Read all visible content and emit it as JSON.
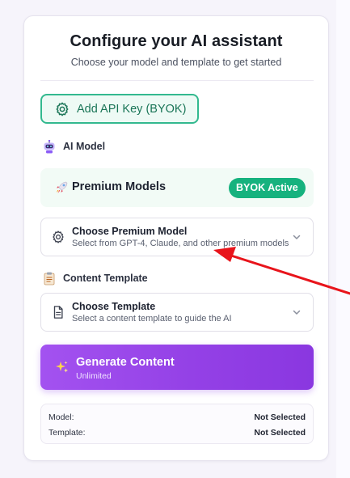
{
  "header": {
    "title": "Configure your AI assistant",
    "subtitle": "Choose your model and template to get started"
  },
  "api_key_button": {
    "label": "Add API Key (BYOK)",
    "icon": "gear-icon"
  },
  "ai_model_section": {
    "label": "AI Model",
    "icon": "robot-icon"
  },
  "premium_banner": {
    "title": "Premium Models",
    "icon": "rocket-icon",
    "badge": "BYOK Active",
    "badge_color": "#16b27e"
  },
  "model_select": {
    "title": "Choose Premium Model",
    "description": "Select from GPT-4, Claude, and other premium models",
    "icon": "gear-icon"
  },
  "template_section": {
    "label": "Content Template",
    "icon": "clipboard-icon"
  },
  "template_select": {
    "title": "Choose Template",
    "description": "Select a content template to guide the AI",
    "icon": "document-icon"
  },
  "generate_button": {
    "title": "Generate Content",
    "subtitle": "Unlimited",
    "icon": "sparkle-icon",
    "color": "#9441e6"
  },
  "summary": {
    "model_label": "Model:",
    "model_value": "Not Selected",
    "template_label": "Template:",
    "template_value": "Not Selected"
  },
  "annotation": {
    "type": "arrow",
    "color": "#e8141b",
    "target": "model_select"
  }
}
